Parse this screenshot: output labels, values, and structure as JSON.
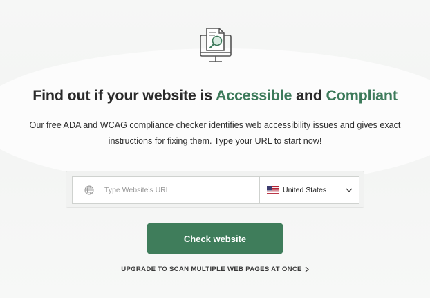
{
  "hero": {
    "icon": "accessibility-audit-monitor-icon",
    "headline": {
      "part1": "Find out if your website is ",
      "highlight1": "Accessible",
      "part2": " and ",
      "highlight2": "Compliant"
    },
    "description": "Our free ADA and WCAG compliance checker identifies web accessibility issues and gives exact instructions for fixing them. Type your URL to start now!"
  },
  "form": {
    "url_placeholder": "Type Website's URL",
    "url_value": "",
    "url_icon": "globe-icon",
    "country": {
      "selected": "United States",
      "flag_icon": "us-flag-icon"
    },
    "submit_label": "Check website"
  },
  "upgrade": {
    "label": "UPGRADE TO SCAN MULTIPLE WEB PAGES AT ONCE"
  },
  "colors": {
    "accent": "#3f7d5b",
    "highlight_text": "#3c7a5a",
    "text": "#2a2a2a"
  }
}
